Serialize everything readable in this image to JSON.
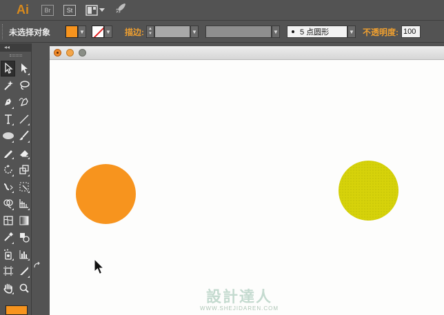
{
  "app": {
    "logo": "Ai",
    "bridge_label": "Br",
    "stock_label": "St",
    "icons": {
      "arrange": "arrange-documents-icon",
      "rocket": "gpu-performance-rocket-icon"
    }
  },
  "control_bar": {
    "selection_status": "未选择对象",
    "fill_color": "#f7941e",
    "stroke_swatch": "none",
    "stroke_label": "描边:",
    "brush_label": "5 点圆形",
    "opacity_label": "不透明度:",
    "opacity_value": "100"
  },
  "tools": {
    "header": "◂◂",
    "fill_swatch_color": "#f7941e"
  },
  "document": {
    "window_lights": [
      "close",
      "minimize",
      "zoom"
    ],
    "objects": [
      {
        "shape": "circle",
        "color": "#f7941e"
      },
      {
        "shape": "circle",
        "color": "#d6d20a"
      }
    ]
  },
  "watermark": {
    "title": "設計達人",
    "url": "WWW.SHEJIDAREN.COM"
  }
}
